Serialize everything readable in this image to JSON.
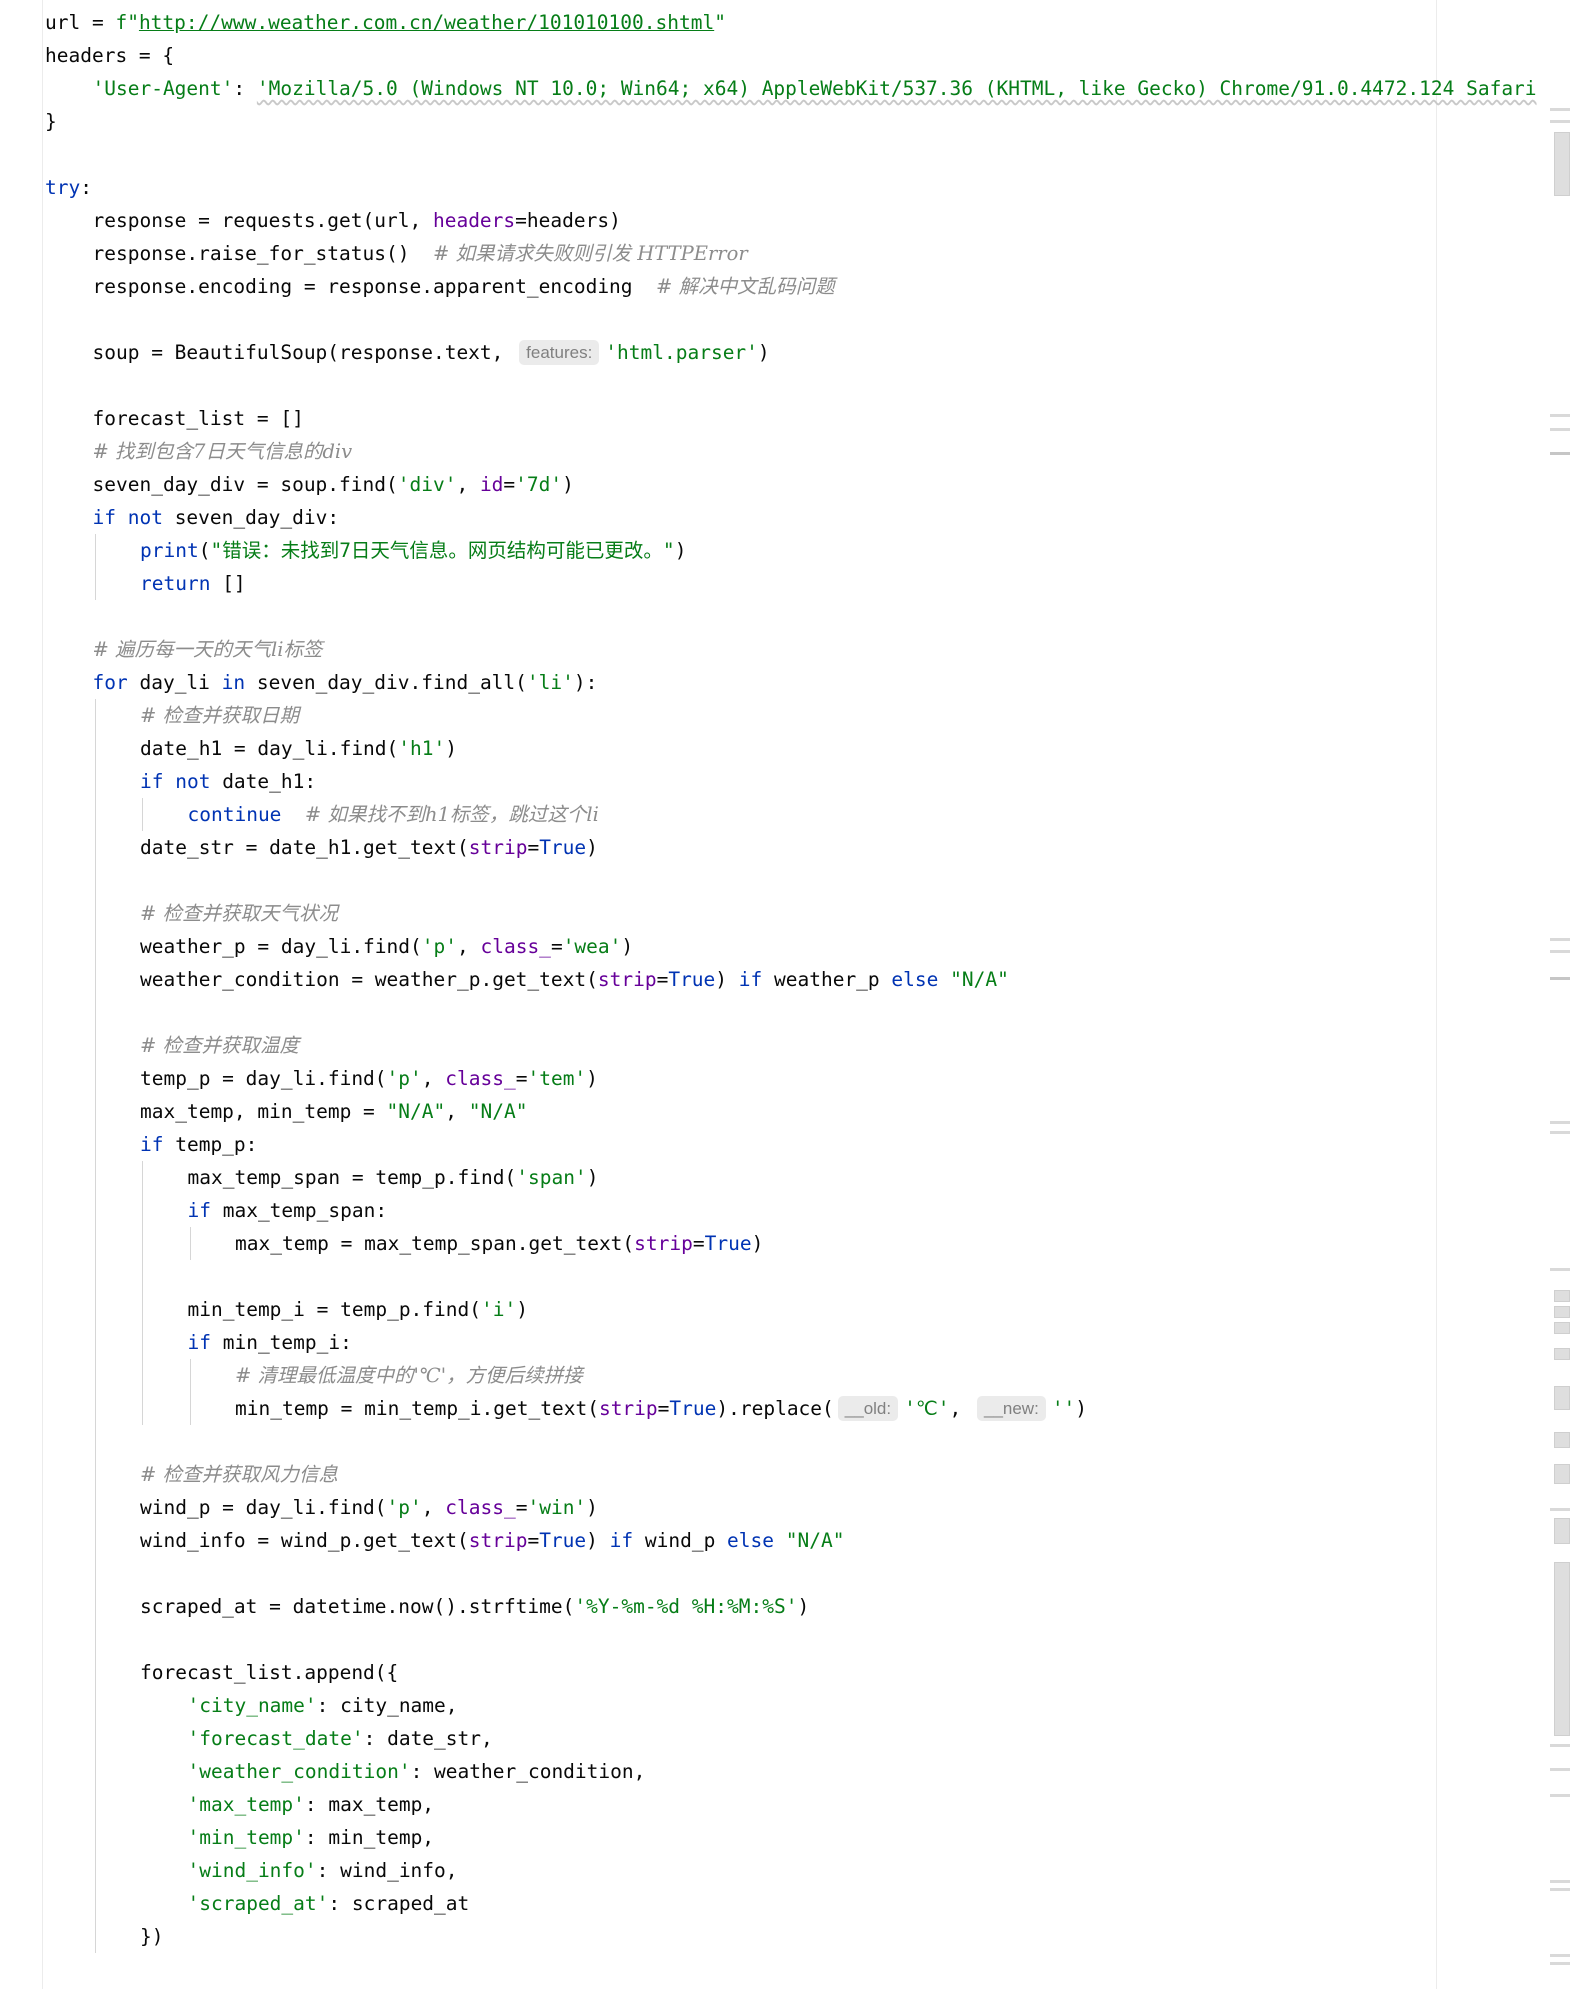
{
  "code": {
    "url_value": "http://www.weather.com.cn/weather/101010100.shtml",
    "user_agent": "'Mozilla/5.0 (Windows NT 10.0; Win64; x64) AppleWebKit/537.36 (KHTML, like Gecko) Chrome/91.0.4472.124 Safari",
    "comments": {
      "raise_for_status": "# 如果请求失败则引发 HTTPError",
      "encoding": "# 解决中文乱码问题",
      "find_div": "# 找到包含7日天气信息的div",
      "loop": "# 遍历每一天的天气li标签",
      "get_date": "# 检查并获取日期",
      "continue": "# 如果找不到h1标签，跳过这个li",
      "get_weather": "# 检查并获取天气状况",
      "get_temp": "# 检查并获取温度",
      "clean_min": "# 清理最低温度中的'℃'，方便后续拼接",
      "get_wind": "# 检查并获取风力信息"
    },
    "strings": {
      "html_parser": "'html.parser'",
      "div": "'div'",
      "seven_d": "'7d'",
      "error_msg": "\"错误：未找到7日天气信息。网页结构可能已更改。\"",
      "li": "'li'",
      "h1": "'h1'",
      "p": "'p'",
      "wea": "'wea'",
      "na": "\"N/A\"",
      "tem": "'tem'",
      "span": "'span'",
      "i": "'i'",
      "celsius": "'℃'",
      "empty": "''",
      "win": "'win'",
      "time_format": "'%Y-%m-%d %H:%M:%S'",
      "city_name": "'city_name'",
      "forecast_date": "'forecast_date'",
      "weather_condition": "'weather_condition'",
      "max_temp": "'max_temp'",
      "min_temp": "'min_temp'",
      "wind_info": "'wind_info'",
      "scraped_at": "'scraped_at'"
    },
    "hints": {
      "features": "features:",
      "old": "__old:",
      "new": "__new:"
    }
  },
  "theme": {
    "keyword": "#0033b3",
    "string": "#067d17",
    "parameter": "#660099",
    "comment": "#8c8c8c",
    "text": "#080808"
  }
}
